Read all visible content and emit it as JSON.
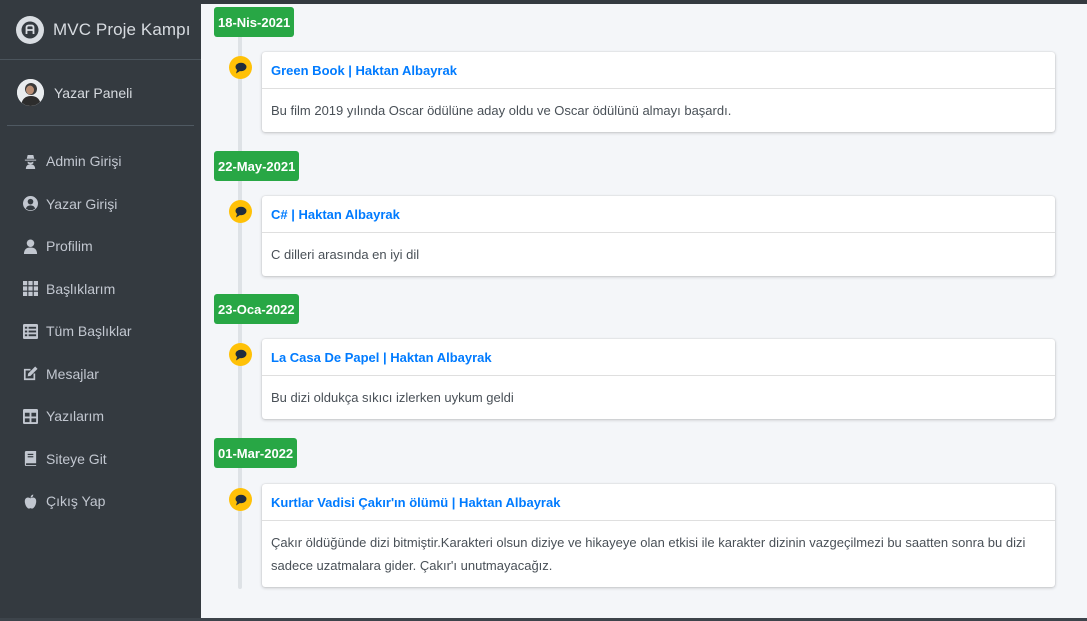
{
  "sidebar": {
    "brand": "MVC Proje Kampı",
    "user_panel": "Yazar Paneli",
    "items": [
      {
        "label": "Admin Girişi",
        "icon": "user-secret-icon"
      },
      {
        "label": "Yazar Girişi",
        "icon": "user-circle-icon"
      },
      {
        "label": "Profilim",
        "icon": "user-icon"
      },
      {
        "label": "Başlıklarım",
        "icon": "grid-icon"
      },
      {
        "label": "Tüm Başlıklar",
        "icon": "list-icon"
      },
      {
        "label": "Mesajlar",
        "icon": "edit-icon"
      },
      {
        "label": "Yazılarım",
        "icon": "table-icon"
      },
      {
        "label": "Siteye Git",
        "icon": "book-icon"
      },
      {
        "label": "Çıkış Yap",
        "icon": "apple-icon"
      }
    ]
  },
  "timeline": [
    {
      "date": "18-Nis-2021",
      "title": "Green Book | Haktan Albayrak",
      "body": "Bu film 2019 yılında Oscar ödülüne aday oldu ve Oscar ödülünü almayı başardı."
    },
    {
      "date": "22-May-2021",
      "title": "C# | Haktan Albayrak",
      "body": "C dilleri arasında en iyi dil"
    },
    {
      "date": "23-Oca-2022",
      "title": "La Casa De Papel | Haktan Albayrak",
      "body": "Bu dizi oldukça sıkıcı izlerken uykum geldi"
    },
    {
      "date": "01-Mar-2022",
      "title": "Kurtlar Vadisi Çakır'ın ölümü | Haktan Albayrak",
      "body": "Çakır öldüğünde dizi bitmiştir.Karakteri olsun diziye ve hikayeye olan etkisi ile karakter dizinin vazgeçilmezi bu saatten sonra bu dizi sadece uzatmalara gider. Çakır'ı unutmayacağız."
    }
  ],
  "colors": {
    "sidebar_bg": "#343a40",
    "date_badge": "#28a745",
    "marker": "#ffc107",
    "link": "#007bff",
    "content_bg": "#f4f6f9"
  }
}
